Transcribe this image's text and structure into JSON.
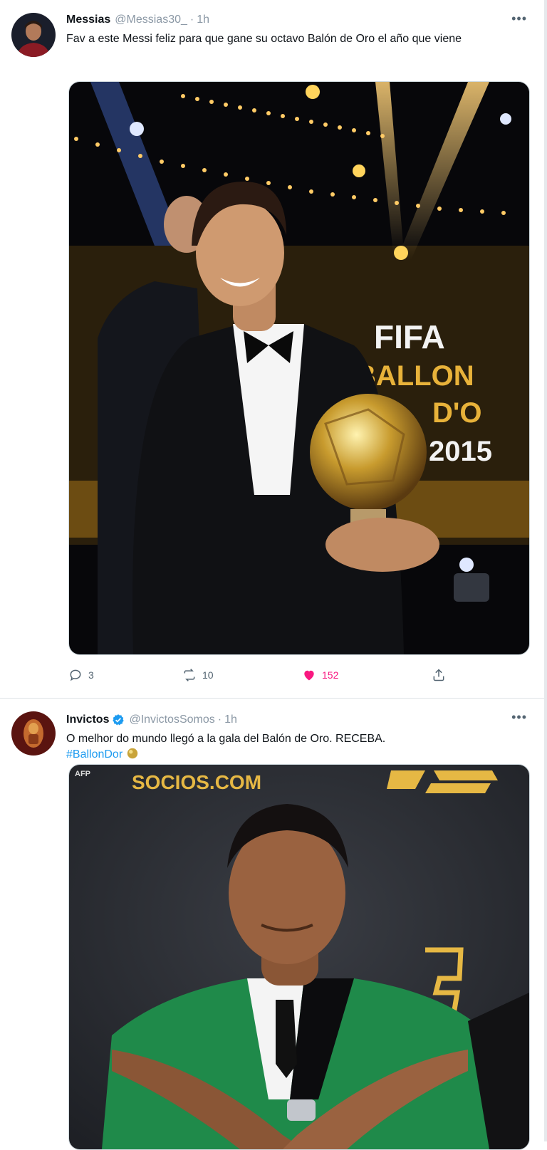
{
  "tweets": [
    {
      "author": {
        "name": "Messias",
        "handle": "@Messias30_",
        "time": "1h"
      },
      "text": "Fav a este Messi feliz para que gane su octavo Balón de Oro el año que viene",
      "media": {
        "signage": [
          "FIFA",
          "BALLON",
          "D'O",
          "2015"
        ]
      },
      "actions": {
        "replies": "3",
        "retweets": "10",
        "likes": "152"
      }
    },
    {
      "author": {
        "name": "Invictos",
        "handle": "@InvictosSomos",
        "time": "1h",
        "verified": true
      },
      "text": "O melhor do mundo llegó a la gala del Balón de Oro. RECEBA.",
      "hashtag": "#BallonDor",
      "media": {
        "watermark": "AFP",
        "brand": "SOCIOS.COM"
      }
    }
  ],
  "icons": [
    "more-icon",
    "reply-icon",
    "retweet-icon",
    "like-icon",
    "share-icon",
    "verified-icon",
    "ballon-dor-emoji-icon"
  ],
  "colors": {
    "like": "#f91880",
    "link": "#1d9bf0",
    "verified": "#1d9bf0",
    "secondary": "#536471"
  }
}
